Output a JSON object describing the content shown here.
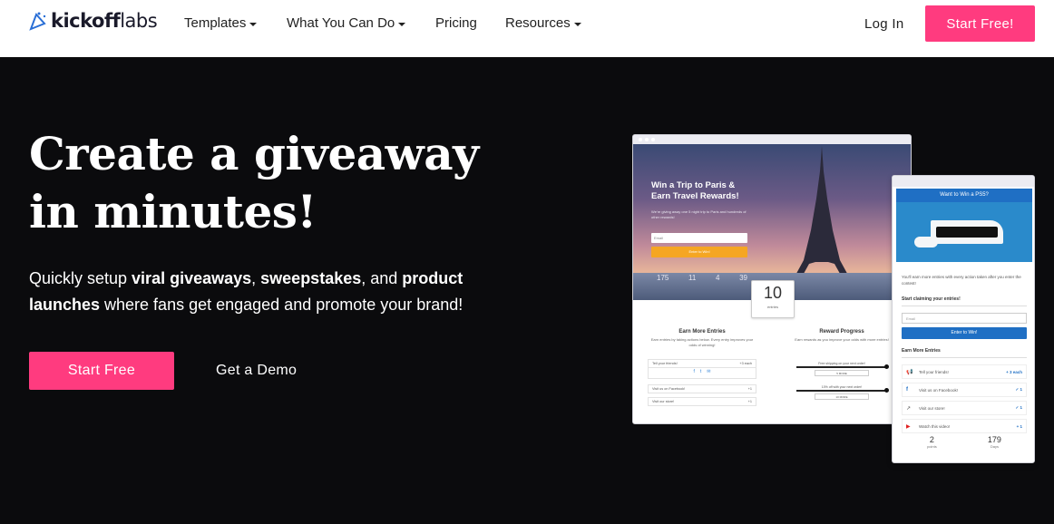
{
  "nav": {
    "logo_text_bold": "kickoff",
    "logo_text_light": "labs",
    "items": [
      {
        "label": "Templates",
        "has_caret": true
      },
      {
        "label": "What You Can Do",
        "has_caret": true
      },
      {
        "label": "Pricing",
        "has_caret": false
      },
      {
        "label": "Resources",
        "has_caret": true
      }
    ],
    "login_label": "Log In",
    "cta_label": "Start Free!"
  },
  "hero": {
    "title_line1": "Create a giveaway",
    "title_line2": "in minutes!",
    "sub_1": "Quickly setup ",
    "sub_b1": "viral giveaways",
    "sub_2": ", ",
    "sub_b2": "sweepstakes",
    "sub_3": ", and ",
    "sub_b3": "product launches",
    "sub_4": " where fans get engaged and promote your brand!",
    "primary_button": "Start Free",
    "secondary_button": "Get a Demo"
  },
  "mockup_desktop": {
    "headline": "Win a Trip to Paris & Earn Travel Rewards!",
    "blurb": "We're giving away one 5 night trip to Paris and hundreds of other rewards!",
    "email_placeholder": "Email",
    "enter_button": "Enter to Win!",
    "countdown": [
      "175",
      "11",
      "4",
      "39"
    ],
    "counter_value": "10",
    "counter_label": "entries",
    "earn_title": "Earn More Entries",
    "earn_desc": "Earn entries by taking actions below. Every entry improves your odds of winning!",
    "reward_title": "Reward Progress",
    "reward_desc": "Earn rewards as you improve your odds with more entries!",
    "actions": [
      {
        "label": "Tell your friends!",
        "value": "+3 each"
      },
      {
        "label": "Visit us on Facebook!",
        "value": "+1"
      },
      {
        "label": "Visit our store!",
        "value": "+1"
      }
    ],
    "rewards": [
      {
        "label": "Free shipping on your next order!",
        "badge": "5 MORE"
      },
      {
        "label": "10% off with your next order!",
        "badge": "10 MORE"
      }
    ]
  },
  "mockup_mobile": {
    "header": "Want to Win a PS5?",
    "body": "You'll earn more entries with every action taken after you enter the contest!",
    "start_title": "Start claiming your entries!",
    "email_placeholder": "Email",
    "enter_button": "Enter to Win!",
    "earn_title": "Earn More Entries",
    "actions": [
      {
        "icon": "megaphone",
        "label": "Tell your friends!",
        "value": "+ 3 each"
      },
      {
        "icon": "facebook",
        "label": "Visit us on Facebook!",
        "value": "✓ 1"
      },
      {
        "icon": "external-link",
        "label": "Visit our store!",
        "value": "✓ 1"
      },
      {
        "icon": "youtube",
        "label": "Watch this video!",
        "value": "+ 1"
      }
    ],
    "stats": [
      {
        "value": "2",
        "label": "points"
      },
      {
        "value": "179",
        "label": "Days"
      }
    ]
  },
  "colors": {
    "accent": "#ff3b7f",
    "background": "#0b0b0d",
    "mobile_blue": "#1f6fc4",
    "desktop_yellow": "#f5a623"
  }
}
